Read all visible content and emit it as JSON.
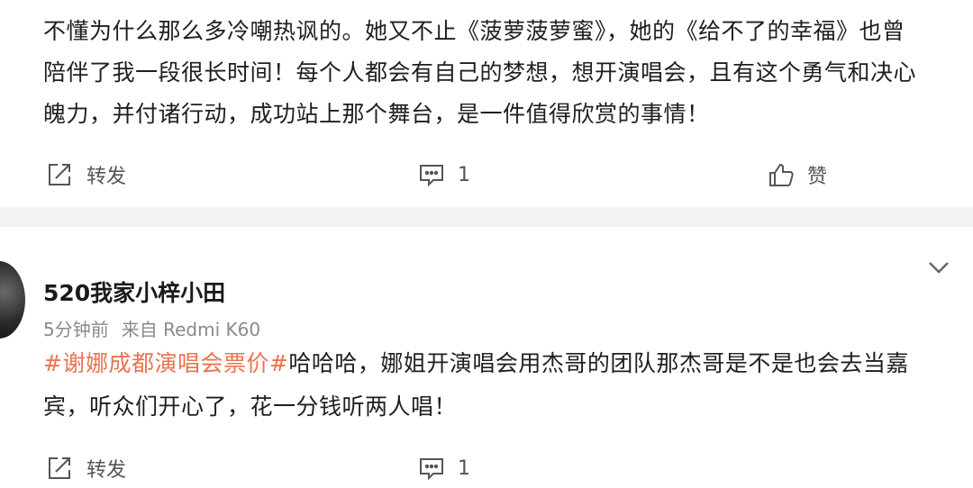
{
  "post1": {
    "lines": [
      "不懂为什么那么多冷嘲热讽的。她又不止《菠萝菠萝蜜》，她的《给不了的幸福》也曾",
      "陪伴了我一段很长时间！每个人都会有自己的梦想，想开演唱会，且有这个勇气和决心",
      "魄力，并付诸行动，成功站上那个舞台，是一件值得欣赏的事情！"
    ],
    "repost_label": "转发",
    "comment_count": "1",
    "like_label": "赞"
  },
  "post2": {
    "username": "520我家小梓小田",
    "time": "5分钟前",
    "source": "来自 Redmi K60",
    "hashtag": "#谢娜成都演唱会票价#",
    "line1_rest": "哈哈哈，娜姐开演唱会用杰哥的团队那杰哥是不是也会去当嘉",
    "line2": "宾，听众们开心了，花一分钱听两人唱！",
    "repost_label": "转发",
    "comment_count": "1"
  },
  "colors": {
    "hashtag": "#eb7350",
    "meta": "#8a8a8a",
    "divider": "#f2f2f2"
  },
  "icons": [
    "repost-icon",
    "comment-icon",
    "like-icon",
    "chevron-down-icon"
  ]
}
